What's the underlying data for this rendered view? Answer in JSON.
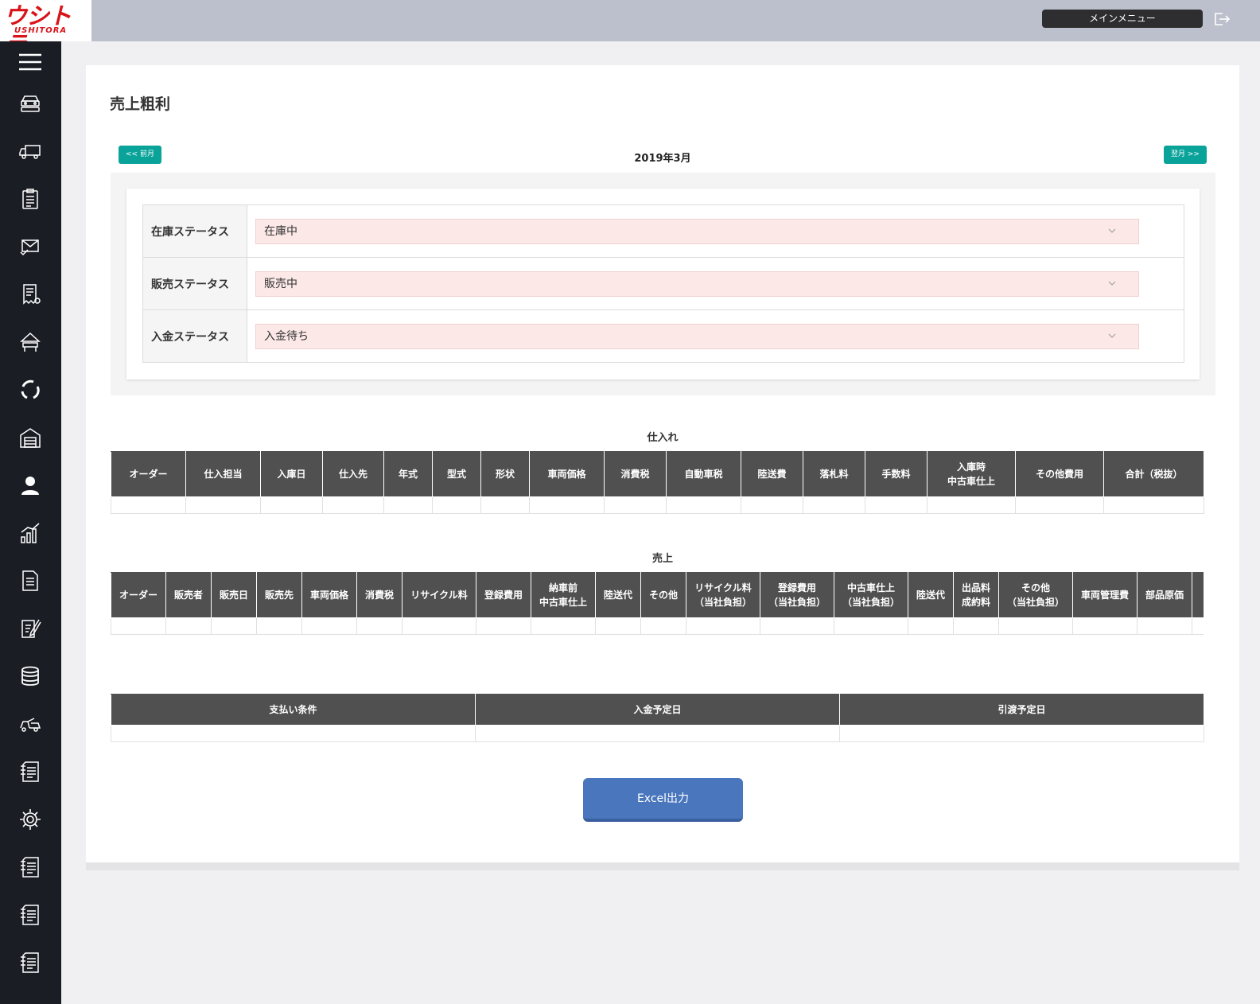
{
  "header": {
    "logo_jp": "ウシトラ",
    "logo_en": "USHITORA",
    "main_menu_label": "メインメニュー"
  },
  "sidebar": {
    "icons": [
      "menu-icon",
      "car-stack-icon",
      "truck-icon",
      "clipboard-icon",
      "mail-check-icon",
      "receipt-icon",
      "auction-icon",
      "cycle-icon",
      "warehouse-icon",
      "user-icon",
      "chart-icon",
      "document-icon",
      "edit-icon",
      "database-icon",
      "tow-truck-icon",
      "doc-list-icon",
      "gear-icon",
      "doc-list-icon",
      "doc-list-icon",
      "doc-list-icon"
    ]
  },
  "page": {
    "title": "売上粗利",
    "prev_label": "<< 前月",
    "next_label": "翌月 >>",
    "month": "2019年3月"
  },
  "filters": [
    {
      "label": "在庫ステータス",
      "value": "在庫中"
    },
    {
      "label": "販売ステータス",
      "value": "販売中"
    },
    {
      "label": "入金ステータス",
      "value": "入金待ち"
    }
  ],
  "purchase": {
    "title": "仕入れ",
    "columns": [
      {
        "l1": "オーダー",
        "l2": ""
      },
      {
        "l1": "仕入担当",
        "l2": ""
      },
      {
        "l1": "入庫日",
        "l2": ""
      },
      {
        "l1": "仕入先",
        "l2": ""
      },
      {
        "l1": "年式",
        "l2": ""
      },
      {
        "l1": "型式",
        "l2": ""
      },
      {
        "l1": "形状",
        "l2": ""
      },
      {
        "l1": "車両価格",
        "l2": ""
      },
      {
        "l1": "消費税",
        "l2": ""
      },
      {
        "l1": "自動車税",
        "l2": ""
      },
      {
        "l1": "陸送費",
        "l2": ""
      },
      {
        "l1": "落札料",
        "l2": ""
      },
      {
        "l1": "手数料",
        "l2": ""
      },
      {
        "l1": "入庫時",
        "l2": "中古車仕上"
      },
      {
        "l1": "その他費用",
        "l2": ""
      },
      {
        "l1": "合計（税抜）",
        "l2": ""
      }
    ]
  },
  "sales": {
    "title": "売上",
    "columns": [
      {
        "l1": "オーダー",
        "l2": ""
      },
      {
        "l1": "販売者",
        "l2": ""
      },
      {
        "l1": "販売日",
        "l2": ""
      },
      {
        "l1": "販売先",
        "l2": ""
      },
      {
        "l1": "車両価格",
        "l2": ""
      },
      {
        "l1": "消費税",
        "l2": ""
      },
      {
        "l1": "リサイクル料",
        "l2": ""
      },
      {
        "l1": "登録費用",
        "l2": ""
      },
      {
        "l1": "納車前",
        "l2": "中古車仕上"
      },
      {
        "l1": "陸送代",
        "l2": ""
      },
      {
        "l1": "その他",
        "l2": ""
      },
      {
        "l1": "リサイクル料",
        "l2": "（当社負担）"
      },
      {
        "l1": "登録費用",
        "l2": "（当社負担）"
      },
      {
        "l1": "中古車仕上",
        "l2": "（当社負担）"
      },
      {
        "l1": "陸送代",
        "l2": ""
      },
      {
        "l1": "出品料",
        "l2": "成約料"
      },
      {
        "l1": "その他",
        "l2": "（当社負担）"
      },
      {
        "l1": "車両管理費",
        "l2": ""
      },
      {
        "l1": "部品原価",
        "l2": ""
      },
      {
        "l1": "ク",
        "l2": ""
      }
    ]
  },
  "payment": {
    "columns": [
      "支払い条件",
      "入金予定日",
      "引渡予定日"
    ]
  },
  "excel_label": "Excel出力"
}
